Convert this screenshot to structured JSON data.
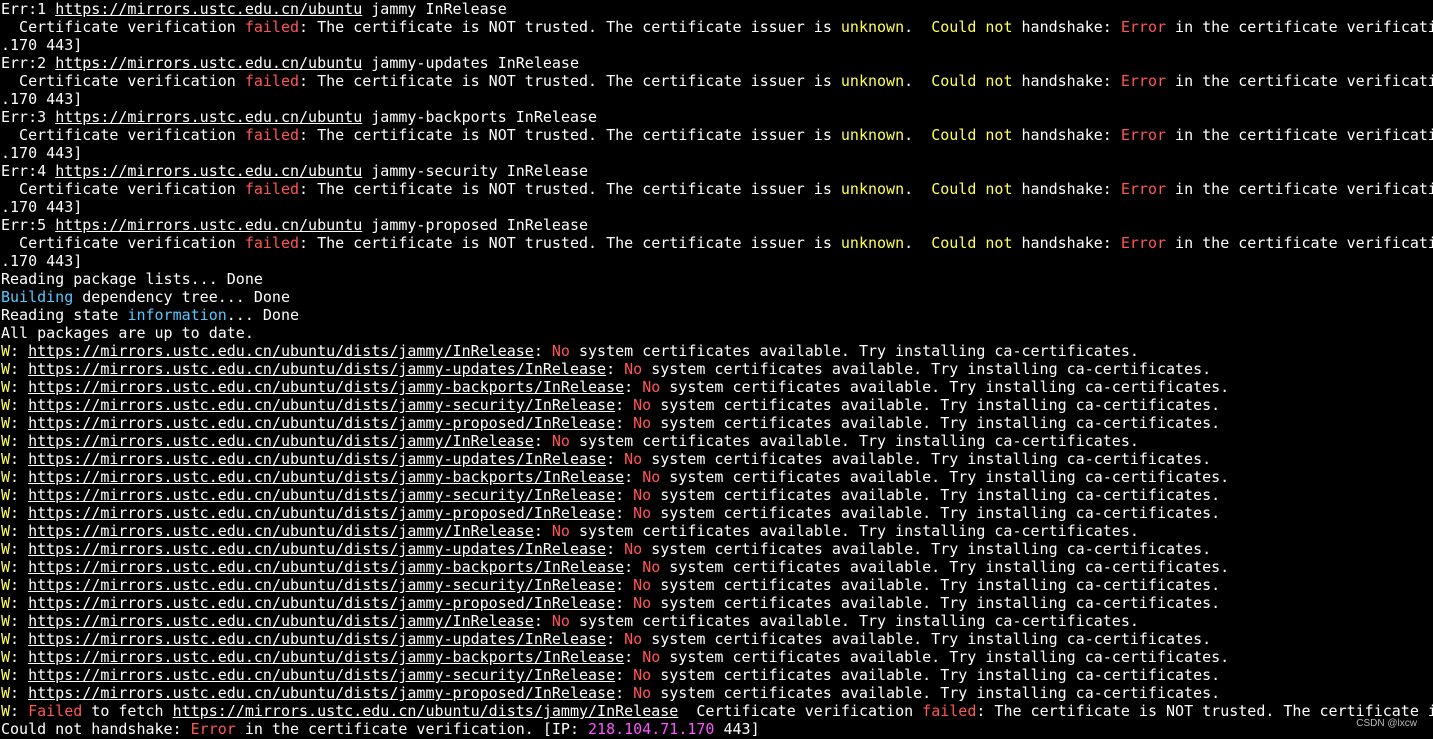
{
  "terminal": {
    "lines": [
      [
        [
          "Err:1 ",
          "w",
          0
        ],
        [
          "https://mirrors.ustc.edu.cn/ubuntu",
          "w",
          1
        ],
        [
          " jammy InRelease",
          "w",
          0
        ]
      ],
      [
        [
          "  Certificate verification ",
          "w",
          0
        ],
        [
          "failed",
          "r",
          0
        ],
        [
          ": The certificate is NOT trusted. The certificate issuer is ",
          "w",
          0
        ],
        [
          "unknown",
          "y",
          0
        ],
        [
          ".  ",
          "w",
          0
        ],
        [
          "Could not",
          "y",
          0
        ],
        [
          " handshake: ",
          "w",
          0
        ],
        [
          "Error",
          "r",
          0
        ],
        [
          " in the certificate verificati",
          "w",
          0
        ]
      ],
      [
        [
          ".170 443]",
          "w",
          0
        ]
      ],
      [
        [
          "Err:2 ",
          "w",
          0
        ],
        [
          "https://mirrors.ustc.edu.cn/ubuntu",
          "w",
          1
        ],
        [
          " jammy-updates InRelease",
          "w",
          0
        ]
      ],
      [
        [
          "  Certificate verification ",
          "w",
          0
        ],
        [
          "failed",
          "r",
          0
        ],
        [
          ": The certificate is NOT trusted. The certificate issuer is ",
          "w",
          0
        ],
        [
          "unknown",
          "y",
          0
        ],
        [
          ".  ",
          "w",
          0
        ],
        [
          "Could not",
          "y",
          0
        ],
        [
          " handshake: ",
          "w",
          0
        ],
        [
          "Error",
          "r",
          0
        ],
        [
          " in the certificate verificati",
          "w",
          0
        ]
      ],
      [
        [
          ".170 443]",
          "w",
          0
        ]
      ],
      [
        [
          "Err:3 ",
          "w",
          0
        ],
        [
          "https://mirrors.ustc.edu.cn/ubuntu",
          "w",
          1
        ],
        [
          " jammy-backports InRelease",
          "w",
          0
        ]
      ],
      [
        [
          "  Certificate verification ",
          "w",
          0
        ],
        [
          "failed",
          "r",
          0
        ],
        [
          ": The certificate is NOT trusted. The certificate issuer is ",
          "w",
          0
        ],
        [
          "unknown",
          "y",
          0
        ],
        [
          ".  ",
          "w",
          0
        ],
        [
          "Could not",
          "y",
          0
        ],
        [
          " handshake: ",
          "w",
          0
        ],
        [
          "Error",
          "r",
          0
        ],
        [
          " in the certificate verificati",
          "w",
          0
        ]
      ],
      [
        [
          ".170 443]",
          "w",
          0
        ]
      ],
      [
        [
          "Err:4 ",
          "w",
          0
        ],
        [
          "https://mirrors.ustc.edu.cn/ubuntu",
          "w",
          1
        ],
        [
          " jammy-security InRelease",
          "w",
          0
        ]
      ],
      [
        [
          "  Certificate verification ",
          "w",
          0
        ],
        [
          "failed",
          "r",
          0
        ],
        [
          ": The certificate is NOT trusted. The certificate issuer is ",
          "w",
          0
        ],
        [
          "unknown",
          "y",
          0
        ],
        [
          ".  ",
          "w",
          0
        ],
        [
          "Could not",
          "y",
          0
        ],
        [
          " handshake: ",
          "w",
          0
        ],
        [
          "Error",
          "r",
          0
        ],
        [
          " in the certificate verificati",
          "w",
          0
        ]
      ],
      [
        [
          ".170 443]",
          "w",
          0
        ]
      ],
      [
        [
          "Err:5 ",
          "w",
          0
        ],
        [
          "https://mirrors.ustc.edu.cn/ubuntu",
          "w",
          1
        ],
        [
          " jammy-proposed InRelease",
          "w",
          0
        ]
      ],
      [
        [
          "  Certificate verification ",
          "w",
          0
        ],
        [
          "failed",
          "r",
          0
        ],
        [
          ": The certificate is NOT trusted. The certificate issuer is ",
          "w",
          0
        ],
        [
          "unknown",
          "y",
          0
        ],
        [
          ".  ",
          "w",
          0
        ],
        [
          "Could not",
          "y",
          0
        ],
        [
          " handshake: ",
          "w",
          0
        ],
        [
          "Error",
          "r",
          0
        ],
        [
          " in the certificate verificati",
          "w",
          0
        ]
      ],
      [
        [
          ".170 443]",
          "w",
          0
        ]
      ],
      [
        [
          "Reading package lists... Done",
          "w",
          0
        ]
      ],
      [
        [
          "Building",
          "c",
          0
        ],
        [
          " dependency tree... Done",
          "w",
          0
        ]
      ],
      [
        [
          "Reading state ",
          "w",
          0
        ],
        [
          "information",
          "c",
          0
        ],
        [
          "... Done",
          "w",
          0
        ]
      ],
      [
        [
          "All packages are up to date.",
          "w",
          0
        ]
      ],
      [
        [
          "W",
          "y",
          0
        ],
        [
          ": ",
          "w",
          0
        ],
        [
          "https://mirrors.ustc.edu.cn/ubuntu/dists/jammy/InRelease",
          "w",
          1
        ],
        [
          ": ",
          "w",
          0
        ],
        [
          "No",
          "r",
          0
        ],
        [
          " system certificates available. Try installing ca-certificates.",
          "w",
          0
        ]
      ],
      [
        [
          "W",
          "y",
          0
        ],
        [
          ": ",
          "w",
          0
        ],
        [
          "https://mirrors.ustc.edu.cn/ubuntu/dists/jammy-updates/InRelease",
          "w",
          1
        ],
        [
          ": ",
          "w",
          0
        ],
        [
          "No",
          "r",
          0
        ],
        [
          " system certificates available. Try installing ca-certificates.",
          "w",
          0
        ]
      ],
      [
        [
          "W",
          "y",
          0
        ],
        [
          ": ",
          "w",
          0
        ],
        [
          "https://mirrors.ustc.edu.cn/ubuntu/dists/jammy-backports/InRelease",
          "w",
          1
        ],
        [
          ": ",
          "w",
          0
        ],
        [
          "No",
          "r",
          0
        ],
        [
          " system certificates available. Try installing ca-certificates.",
          "w",
          0
        ]
      ],
      [
        [
          "W",
          "y",
          0
        ],
        [
          ": ",
          "w",
          0
        ],
        [
          "https://mirrors.ustc.edu.cn/ubuntu/dists/jammy-security/InRelease",
          "w",
          1
        ],
        [
          ": ",
          "w",
          0
        ],
        [
          "No",
          "r",
          0
        ],
        [
          " system certificates available. Try installing ca-certificates.",
          "w",
          0
        ]
      ],
      [
        [
          "W",
          "y",
          0
        ],
        [
          ": ",
          "w",
          0
        ],
        [
          "https://mirrors.ustc.edu.cn/ubuntu/dists/jammy-proposed/InRelease",
          "w",
          1
        ],
        [
          ": ",
          "w",
          0
        ],
        [
          "No",
          "r",
          0
        ],
        [
          " system certificates available. Try installing ca-certificates.",
          "w",
          0
        ]
      ],
      [
        [
          "W",
          "y",
          0
        ],
        [
          ": ",
          "w",
          0
        ],
        [
          "https://mirrors.ustc.edu.cn/ubuntu/dists/jammy/InRelease",
          "w",
          1
        ],
        [
          ": ",
          "w",
          0
        ],
        [
          "No",
          "r",
          0
        ],
        [
          " system certificates available. Try installing ca-certificates.",
          "w",
          0
        ]
      ],
      [
        [
          "W",
          "y",
          0
        ],
        [
          ": ",
          "w",
          0
        ],
        [
          "https://mirrors.ustc.edu.cn/ubuntu/dists/jammy-updates/InRelease",
          "w",
          1
        ],
        [
          ": ",
          "w",
          0
        ],
        [
          "No",
          "r",
          0
        ],
        [
          " system certificates available. Try installing ca-certificates.",
          "w",
          0
        ]
      ],
      [
        [
          "W",
          "y",
          0
        ],
        [
          ": ",
          "w",
          0
        ],
        [
          "https://mirrors.ustc.edu.cn/ubuntu/dists/jammy-backports/InRelease",
          "w",
          1
        ],
        [
          ": ",
          "w",
          0
        ],
        [
          "No",
          "r",
          0
        ],
        [
          " system certificates available. Try installing ca-certificates.",
          "w",
          0
        ]
      ],
      [
        [
          "W",
          "y",
          0
        ],
        [
          ": ",
          "w",
          0
        ],
        [
          "https://mirrors.ustc.edu.cn/ubuntu/dists/jammy-security/InRelease",
          "w",
          1
        ],
        [
          ": ",
          "w",
          0
        ],
        [
          "No",
          "r",
          0
        ],
        [
          " system certificates available. Try installing ca-certificates.",
          "w",
          0
        ]
      ],
      [
        [
          "W",
          "y",
          0
        ],
        [
          ": ",
          "w",
          0
        ],
        [
          "https://mirrors.ustc.edu.cn/ubuntu/dists/jammy-proposed/InRelease",
          "w",
          1
        ],
        [
          ": ",
          "w",
          0
        ],
        [
          "No",
          "r",
          0
        ],
        [
          " system certificates available. Try installing ca-certificates.",
          "w",
          0
        ]
      ],
      [
        [
          "W",
          "y",
          0
        ],
        [
          ": ",
          "w",
          0
        ],
        [
          "https://mirrors.ustc.edu.cn/ubuntu/dists/jammy/InRelease",
          "w",
          1
        ],
        [
          ": ",
          "w",
          0
        ],
        [
          "No",
          "r",
          0
        ],
        [
          " system certificates available. Try installing ca-certificates.",
          "w",
          0
        ]
      ],
      [
        [
          "W",
          "y",
          0
        ],
        [
          ": ",
          "w",
          0
        ],
        [
          "https://mirrors.ustc.edu.cn/ubuntu/dists/jammy-updates/InRelease",
          "w",
          1
        ],
        [
          ": ",
          "w",
          0
        ],
        [
          "No",
          "r",
          0
        ],
        [
          " system certificates available. Try installing ca-certificates.",
          "w",
          0
        ]
      ],
      [
        [
          "W",
          "y",
          0
        ],
        [
          ": ",
          "w",
          0
        ],
        [
          "https://mirrors.ustc.edu.cn/ubuntu/dists/jammy-backports/InRelease",
          "w",
          1
        ],
        [
          ": ",
          "w",
          0
        ],
        [
          "No",
          "r",
          0
        ],
        [
          " system certificates available. Try installing ca-certificates.",
          "w",
          0
        ]
      ],
      [
        [
          "W",
          "y",
          0
        ],
        [
          ": ",
          "w",
          0
        ],
        [
          "https://mirrors.ustc.edu.cn/ubuntu/dists/jammy-security/InRelease",
          "w",
          1
        ],
        [
          ": ",
          "w",
          0
        ],
        [
          "No",
          "r",
          0
        ],
        [
          " system certificates available. Try installing ca-certificates.",
          "w",
          0
        ]
      ],
      [
        [
          "W",
          "y",
          0
        ],
        [
          ": ",
          "w",
          0
        ],
        [
          "https://mirrors.ustc.edu.cn/ubuntu/dists/jammy-proposed/InRelease",
          "w",
          1
        ],
        [
          ": ",
          "w",
          0
        ],
        [
          "No",
          "r",
          0
        ],
        [
          " system certificates available. Try installing ca-certificates.",
          "w",
          0
        ]
      ],
      [
        [
          "W",
          "y",
          0
        ],
        [
          ": ",
          "w",
          0
        ],
        [
          "https://mirrors.ustc.edu.cn/ubuntu/dists/jammy/InRelease",
          "w",
          1
        ],
        [
          ": ",
          "w",
          0
        ],
        [
          "No",
          "r",
          0
        ],
        [
          " system certificates available. Try installing ca-certificates.",
          "w",
          0
        ]
      ],
      [
        [
          "W",
          "y",
          0
        ],
        [
          ": ",
          "w",
          0
        ],
        [
          "https://mirrors.ustc.edu.cn/ubuntu/dists/jammy-updates/InRelease",
          "w",
          1
        ],
        [
          ": ",
          "w",
          0
        ],
        [
          "No",
          "r",
          0
        ],
        [
          " system certificates available. Try installing ca-certificates.",
          "w",
          0
        ]
      ],
      [
        [
          "W",
          "y",
          0
        ],
        [
          ": ",
          "w",
          0
        ],
        [
          "https://mirrors.ustc.edu.cn/ubuntu/dists/jammy-backports/InRelease",
          "w",
          1
        ],
        [
          ": ",
          "w",
          0
        ],
        [
          "No",
          "r",
          0
        ],
        [
          " system certificates available. Try installing ca-certificates.",
          "w",
          0
        ]
      ],
      [
        [
          "W",
          "y",
          0
        ],
        [
          ": ",
          "w",
          0
        ],
        [
          "https://mirrors.ustc.edu.cn/ubuntu/dists/jammy-security/InRelease",
          "w",
          1
        ],
        [
          ": ",
          "w",
          0
        ],
        [
          "No",
          "r",
          0
        ],
        [
          " system certificates available. Try installing ca-certificates.",
          "w",
          0
        ]
      ],
      [
        [
          "W",
          "y",
          0
        ],
        [
          ": ",
          "w",
          0
        ],
        [
          "https://mirrors.ustc.edu.cn/ubuntu/dists/jammy-proposed/InRelease",
          "w",
          1
        ],
        [
          ": ",
          "w",
          0
        ],
        [
          "No",
          "r",
          0
        ],
        [
          " system certificates available. Try installing ca-certificates.",
          "w",
          0
        ]
      ],
      [
        [
          "W",
          "y",
          0
        ],
        [
          ": ",
          "w",
          0
        ],
        [
          "Failed",
          "r",
          0
        ],
        [
          " to fetch ",
          "w",
          0
        ],
        [
          "https://mirrors.ustc.edu.cn/ubuntu/dists/jammy/InRelease",
          "w",
          1
        ],
        [
          "  Certificate verification ",
          "w",
          0
        ],
        [
          "failed",
          "r",
          0
        ],
        [
          ": The certificate is NOT trusted. The certificate i",
          "w",
          0
        ]
      ],
      [
        [
          "Could not handshake: ",
          "w",
          0
        ],
        [
          "Error",
          "r",
          0
        ],
        [
          " in the certificate verification. [IP: ",
          "w",
          0
        ],
        [
          "218.104.71.170",
          "m",
          0
        ],
        [
          " 443]",
          "w",
          0
        ]
      ]
    ]
  },
  "watermark": "CSDN @lxcw",
  "colors": {
    "background": "#000000",
    "text": "#ffffff",
    "error_red": "#ff5555",
    "warn_yellow": "#ffff55",
    "info_cyan": "#55c8ff",
    "ip_magenta": "#ff55ff"
  }
}
